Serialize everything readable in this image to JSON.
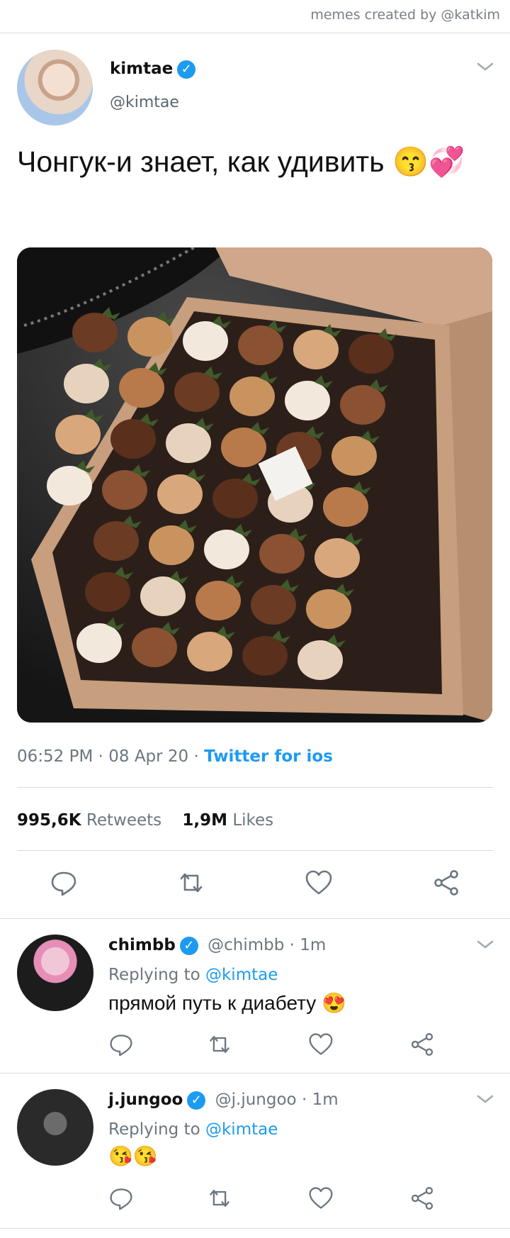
{
  "credit": "memes created by @katkim",
  "tweet": {
    "author_name": "kimtae",
    "author_handle": "@kimtae",
    "text": "Чонгук-и знает, как удивить 😙💞",
    "time": "06:52 PM",
    "date": "08 Apr 20",
    "source": "Twitter for ios",
    "retweets_count": "995,6K",
    "retweets_label": "Retweets",
    "likes_count": "1,9M",
    "likes_label": "Likes"
  },
  "replies": [
    {
      "name": "chimbb",
      "handle": "@chimbb · 1m",
      "replying_prefix": "Replying to",
      "replying_to": "@kimtae",
      "text": "прямой путь к диабету 😍"
    },
    {
      "name": "j.jungoo",
      "handle": "@j.jungoo · 1m",
      "replying_prefix": "Replying to",
      "replying_to": "@kimtae",
      "text": "😘😘"
    }
  ],
  "icons": {
    "verified": "verified-check-icon",
    "reply": "reply-bubble-icon",
    "retweet": "retweet-icon",
    "like": "heart-icon",
    "share": "share-icon",
    "menu": "chevron-down-icon"
  },
  "colors": {
    "accent": "#1d9bf0",
    "muted": "#6c7680",
    "divider": "#d8dce0"
  }
}
